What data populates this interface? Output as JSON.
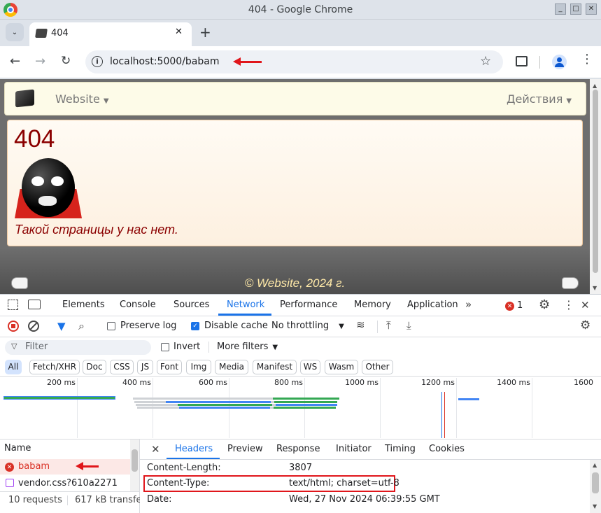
{
  "window": {
    "title": "404 - Google Chrome"
  },
  "tab": {
    "title": "404"
  },
  "address": {
    "url": "localhost:5000/babam"
  },
  "site": {
    "nav_website": "Website",
    "nav_actions": "Действия",
    "error_code": "404",
    "error_message": "Такой страницы у нас нет.",
    "footer_text": "© Website, 2024 г."
  },
  "devtools": {
    "tabs": [
      "Elements",
      "Console",
      "Sources",
      "Network",
      "Performance",
      "Memory",
      "Application"
    ],
    "active_tab": "Network",
    "error_count": "1",
    "preserve_log": "Preserve log",
    "disable_cache": "Disable cache",
    "throttling": "No throttling",
    "filter_placeholder": "Filter",
    "invert": "Invert",
    "more_filters": "More filters",
    "type_filters": [
      "All",
      "Fetch/XHR",
      "Doc",
      "CSS",
      "JS",
      "Font",
      "Img",
      "Media",
      "Manifest",
      "WS",
      "Wasm",
      "Other"
    ],
    "timeline_ticks": [
      "200 ms",
      "400 ms",
      "600 ms",
      "800 ms",
      "1000 ms",
      "1200 ms",
      "1400 ms",
      "1600"
    ],
    "name_header": "Name",
    "requests": [
      "babam",
      "vendor.css?610a2271"
    ],
    "summary_requests": "10 requests",
    "summary_transfer": "617 kB transfe",
    "detail_tabs": [
      "Headers",
      "Preview",
      "Response",
      "Initiator",
      "Timing",
      "Cookies"
    ],
    "headers": [
      {
        "key": "Content-Length:",
        "value": "3807"
      },
      {
        "key": "Content-Type:",
        "value": "text/html; charset=utf-8"
      },
      {
        "key": "Date:",
        "value": "Wed, 27 Nov 2024 06:39:55 GMT"
      }
    ]
  },
  "colors": {
    "accent": "#1a73e8",
    "error": "#d93025",
    "annotation": "#e0161b",
    "page_text": "#8b0000"
  }
}
